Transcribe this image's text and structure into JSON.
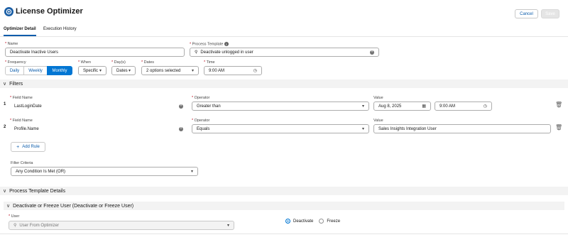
{
  "app": {
    "title": "License Optimizer"
  },
  "header": {
    "cancel_label": "Cancel",
    "save_label": "Save"
  },
  "tabs": [
    {
      "label": "Optimizer Detail"
    },
    {
      "label": "Execution History"
    }
  ],
  "form": {
    "name": {
      "label": "Name",
      "value": "Deactivate Inactive Users"
    },
    "process_template": {
      "label": "Process Template",
      "value": "Deactivate unlogged in user"
    },
    "frequency": {
      "label": "Frequency",
      "options": [
        "Daily",
        "Weekly",
        "Monthly"
      ],
      "selected": "Monthly"
    },
    "when": {
      "label": "When",
      "value": "Specific"
    },
    "days": {
      "label": "Day(s)",
      "value": "Dates"
    },
    "dates": {
      "label": "Dates",
      "value": "2 options selected"
    },
    "time": {
      "label": "Time",
      "value": "9:00 AM"
    }
  },
  "filters": {
    "title": "Filters",
    "rows": [
      {
        "num": "1",
        "field_label": "Field Name",
        "field": "LastLoginDate",
        "op_label": "Operator",
        "operator": "Greater than",
        "value_label": "Value",
        "date": "Aug 8, 2025",
        "time": "9:00 AM"
      },
      {
        "num": "2",
        "field_label": "Field Name",
        "field": "Profile.Name",
        "op_label": "Operator",
        "operator": "Equals",
        "value_label": "Value",
        "value": "Sales Insights Integration User"
      }
    ],
    "add_rule_label": "Add Rule",
    "criteria_label": "Filter Criteria",
    "criteria_value": "Any Condition Is Met (OR)"
  },
  "process_details": {
    "title": "Process Template Details",
    "subsection": "Deactivate or Freeze User (Deactivate or Freeze User)",
    "user_label": "User",
    "user_placeholder": "User From Optimizer",
    "action_options": [
      "Deactivate",
      "Freeze"
    ],
    "action_selected": "Deactivate"
  },
  "colors": {
    "brand": "#0176d3",
    "link": "#0b5cab",
    "required": "#ba0517",
    "section_bg": "#f3f3f3"
  },
  "icons": [
    "app-logo-icon",
    "info-icon",
    "search-icon",
    "clear-icon",
    "chevron-down-icon",
    "clock-icon",
    "calendar-icon",
    "trash-icon",
    "plus-icon",
    "chevron-section-icon"
  ]
}
